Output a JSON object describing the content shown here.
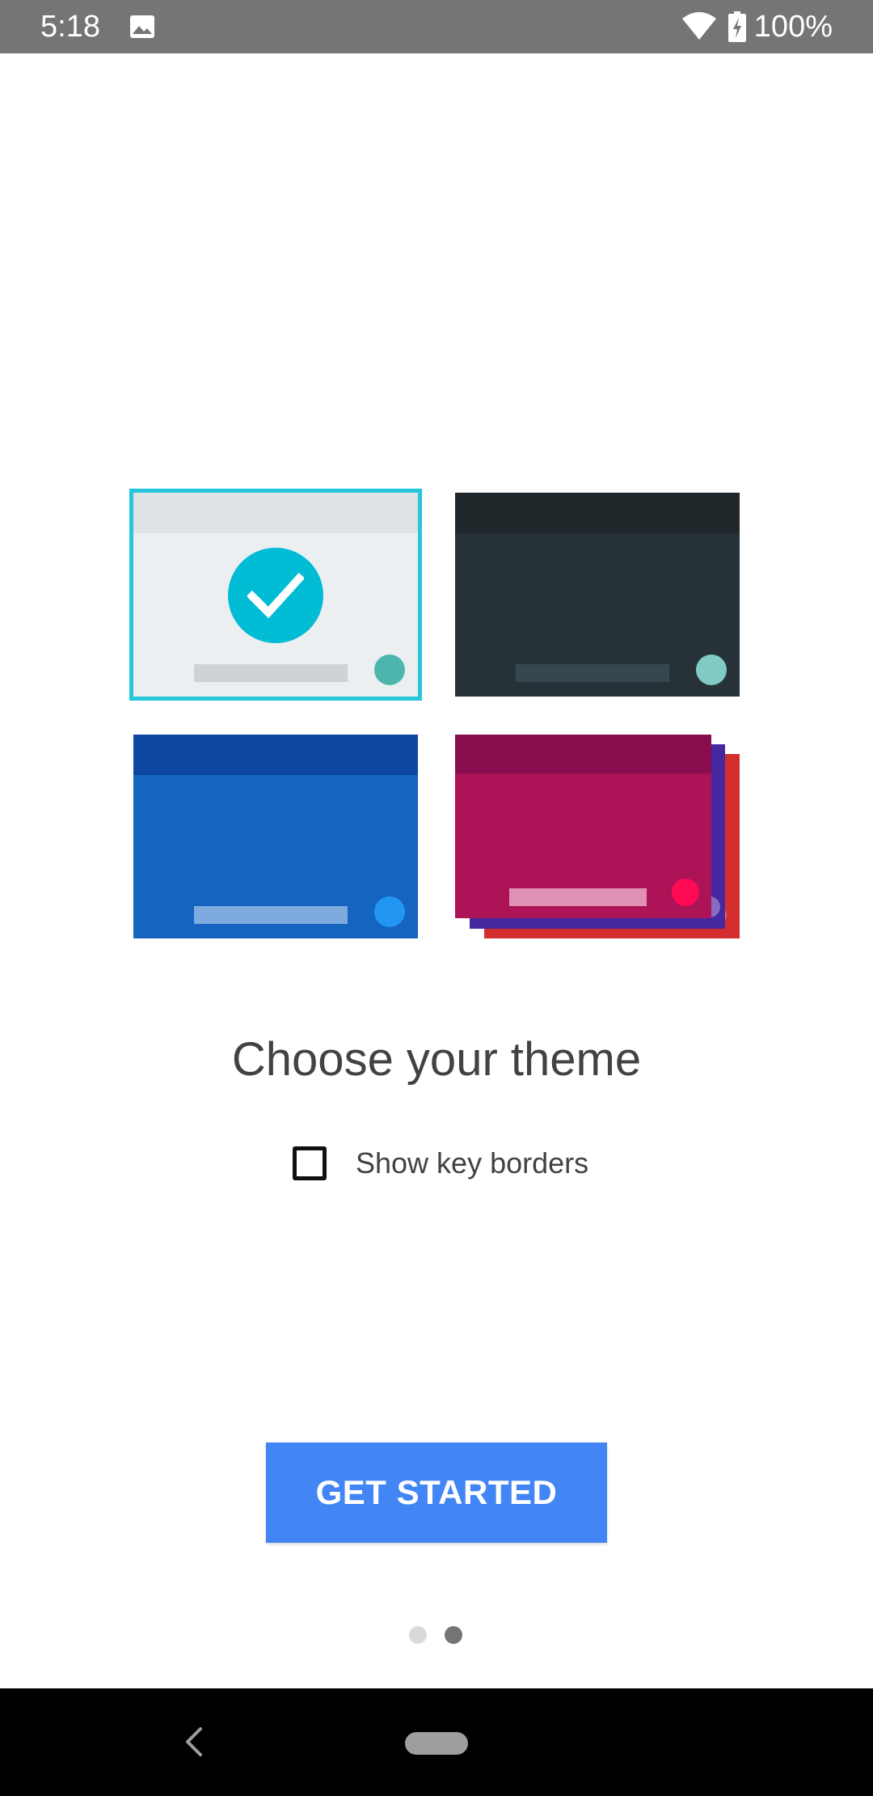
{
  "status_bar": {
    "time": "5:18",
    "battery": "100%",
    "icons": [
      "image-icon",
      "wifi-icon",
      "battery-charging-icon"
    ]
  },
  "themes": [
    {
      "name": "light",
      "selected": true,
      "accent": "#26c6da"
    },
    {
      "name": "dark",
      "selected": false
    },
    {
      "name": "blue",
      "selected": false
    },
    {
      "name": "colorful",
      "selected": false
    }
  ],
  "main": {
    "title": "Choose your theme",
    "checkbox_label": "Show key borders",
    "checkbox_checked": false,
    "button_label": "GET STARTED"
  },
  "pager": {
    "pages": 2,
    "current": 2
  },
  "colors": {
    "primary_button": "#4285f4",
    "status_bar": "#757575",
    "selected_outline": "#26c6da"
  }
}
